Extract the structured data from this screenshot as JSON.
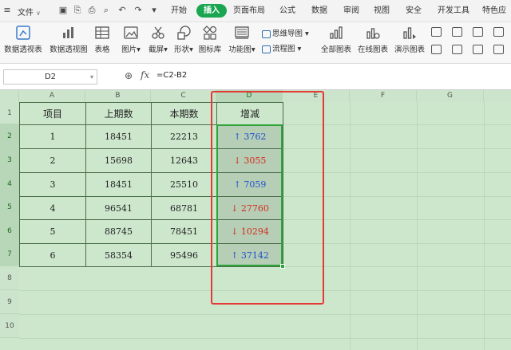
{
  "menubar": {
    "file": "文件",
    "items": [
      {
        "label": "开始",
        "active": false
      },
      {
        "label": "插入",
        "active": true
      },
      {
        "label": "页面布局",
        "active": false
      },
      {
        "label": "公式",
        "active": false
      },
      {
        "label": "数据",
        "active": false
      },
      {
        "label": "审阅",
        "active": false
      },
      {
        "label": "视图",
        "active": false
      },
      {
        "label": "安全",
        "active": false
      },
      {
        "label": "开发工具",
        "active": false
      },
      {
        "label": "特色应",
        "active": false
      }
    ]
  },
  "toolbar": {
    "pivot_table": "数据透视表",
    "pivot_chart": "数据透视图",
    "table": "表格",
    "picture": "图片",
    "screenshot": "截屏",
    "shape": "形状",
    "icon_lib": "图标库",
    "function_chart": "功能图",
    "mind_map": "思维导图",
    "flowchart": "流程图",
    "all_charts": "全部图表",
    "online_charts": "在线图表",
    "demo_charts": "演示图表"
  },
  "formula_bar": {
    "name_box": "D2",
    "fx": "fx",
    "formula": "=C2-B2"
  },
  "sheet": {
    "columns": [
      "A",
      "B",
      "C",
      "D",
      "E",
      "F",
      "G"
    ],
    "rows": [
      "1",
      "2",
      "3",
      "4",
      "5",
      "6",
      "7",
      "8",
      "9",
      "10"
    ],
    "headers": [
      "项目",
      "上期数",
      "本期数",
      "增减"
    ],
    "data": [
      {
        "item": "1",
        "prev": "18451",
        "curr": "22213",
        "delta": "↑ 3762",
        "dir": "up"
      },
      {
        "item": "2",
        "prev": "15698",
        "curr": "12643",
        "delta": "↓ 3055",
        "dir": "down"
      },
      {
        "item": "3",
        "prev": "18451",
        "curr": "25510",
        "delta": "↑ 7059",
        "dir": "up"
      },
      {
        "item": "4",
        "prev": "96541",
        "curr": "68781",
        "delta": "↓ 27760",
        "dir": "down"
      },
      {
        "item": "5",
        "prev": "88745",
        "curr": "78451",
        "delta": "↓ 10294",
        "dir": "down"
      },
      {
        "item": "6",
        "prev": "58354",
        "curr": "95496",
        "delta": "↑ 37142",
        "dir": "up"
      }
    ]
  },
  "colors": {
    "accent": "#1aa650",
    "up": "#1f4fd1",
    "down": "#d62b1f",
    "highlight_box": "#e53935",
    "sheet_bg": "#cde7cd"
  }
}
